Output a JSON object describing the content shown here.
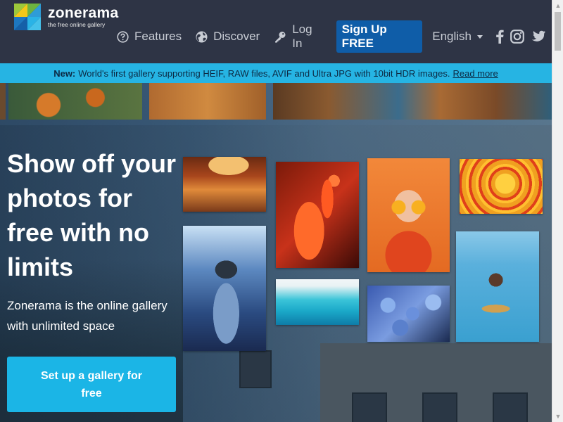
{
  "brand": {
    "name": "zonerama",
    "tagline": "the free online gallery"
  },
  "nav": {
    "features": "Features",
    "discover": "Discover",
    "login": "Log In",
    "signup": "Sign Up FREE",
    "language": "English"
  },
  "banner": {
    "prefix": "New:",
    "text": "World's first gallery supporting HEIF, RAW files, AVIF and Ultra JPG with 10bit HDR images.",
    "link": "Read more"
  },
  "hero": {
    "headline": "Show off your photos for free with no limits",
    "subtext": "Zonerama is the online gallery with unlimited space",
    "cta": "Set up a gallery for free"
  },
  "icons": {
    "features": "question-circle-icon",
    "discover": "globe-icon",
    "login": "key-icon",
    "facebook": "facebook-icon",
    "instagram": "instagram-icon",
    "twitter": "twitter-icon"
  },
  "colors": {
    "header_bg": "#2e3445",
    "banner_bg": "#26b4e3",
    "signup_bg": "#0f5da8",
    "cta_bg": "#1bb5e6"
  }
}
